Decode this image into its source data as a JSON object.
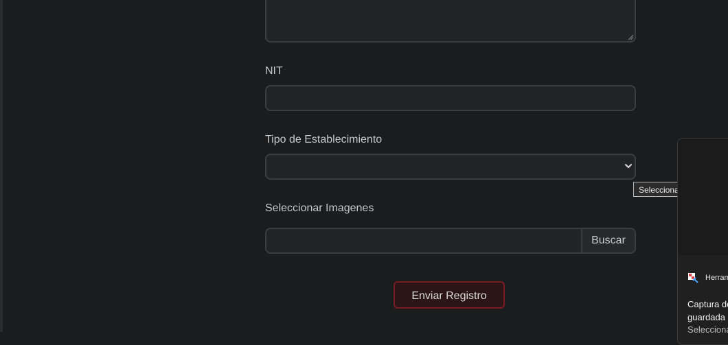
{
  "form": {
    "nit_label": "NIT",
    "nit_value": "",
    "establishment_type_label": "Tipo de Establecimiento",
    "establishment_type_selected": "",
    "images_label": "Seleccionar Imagenes",
    "browse_button_label": "Buscar",
    "submit_label": "Enviar Registro"
  },
  "tooltip": {
    "text": "Seleccionar"
  },
  "toast": {
    "app_name": "Herramienta",
    "title_line1": "Captura de pantalla copiada y",
    "title_line2": "guardada",
    "body": "Selecciona aquí"
  },
  "icons": {
    "select_chevron": "chevron-down-icon",
    "snipping_tool": "snipping-tool-icon"
  },
  "colors": {
    "background": "#1b1c1e",
    "field_border": "#3b3d40",
    "submit_border": "#7a1d22",
    "submit_bg": "#2b1517"
  }
}
